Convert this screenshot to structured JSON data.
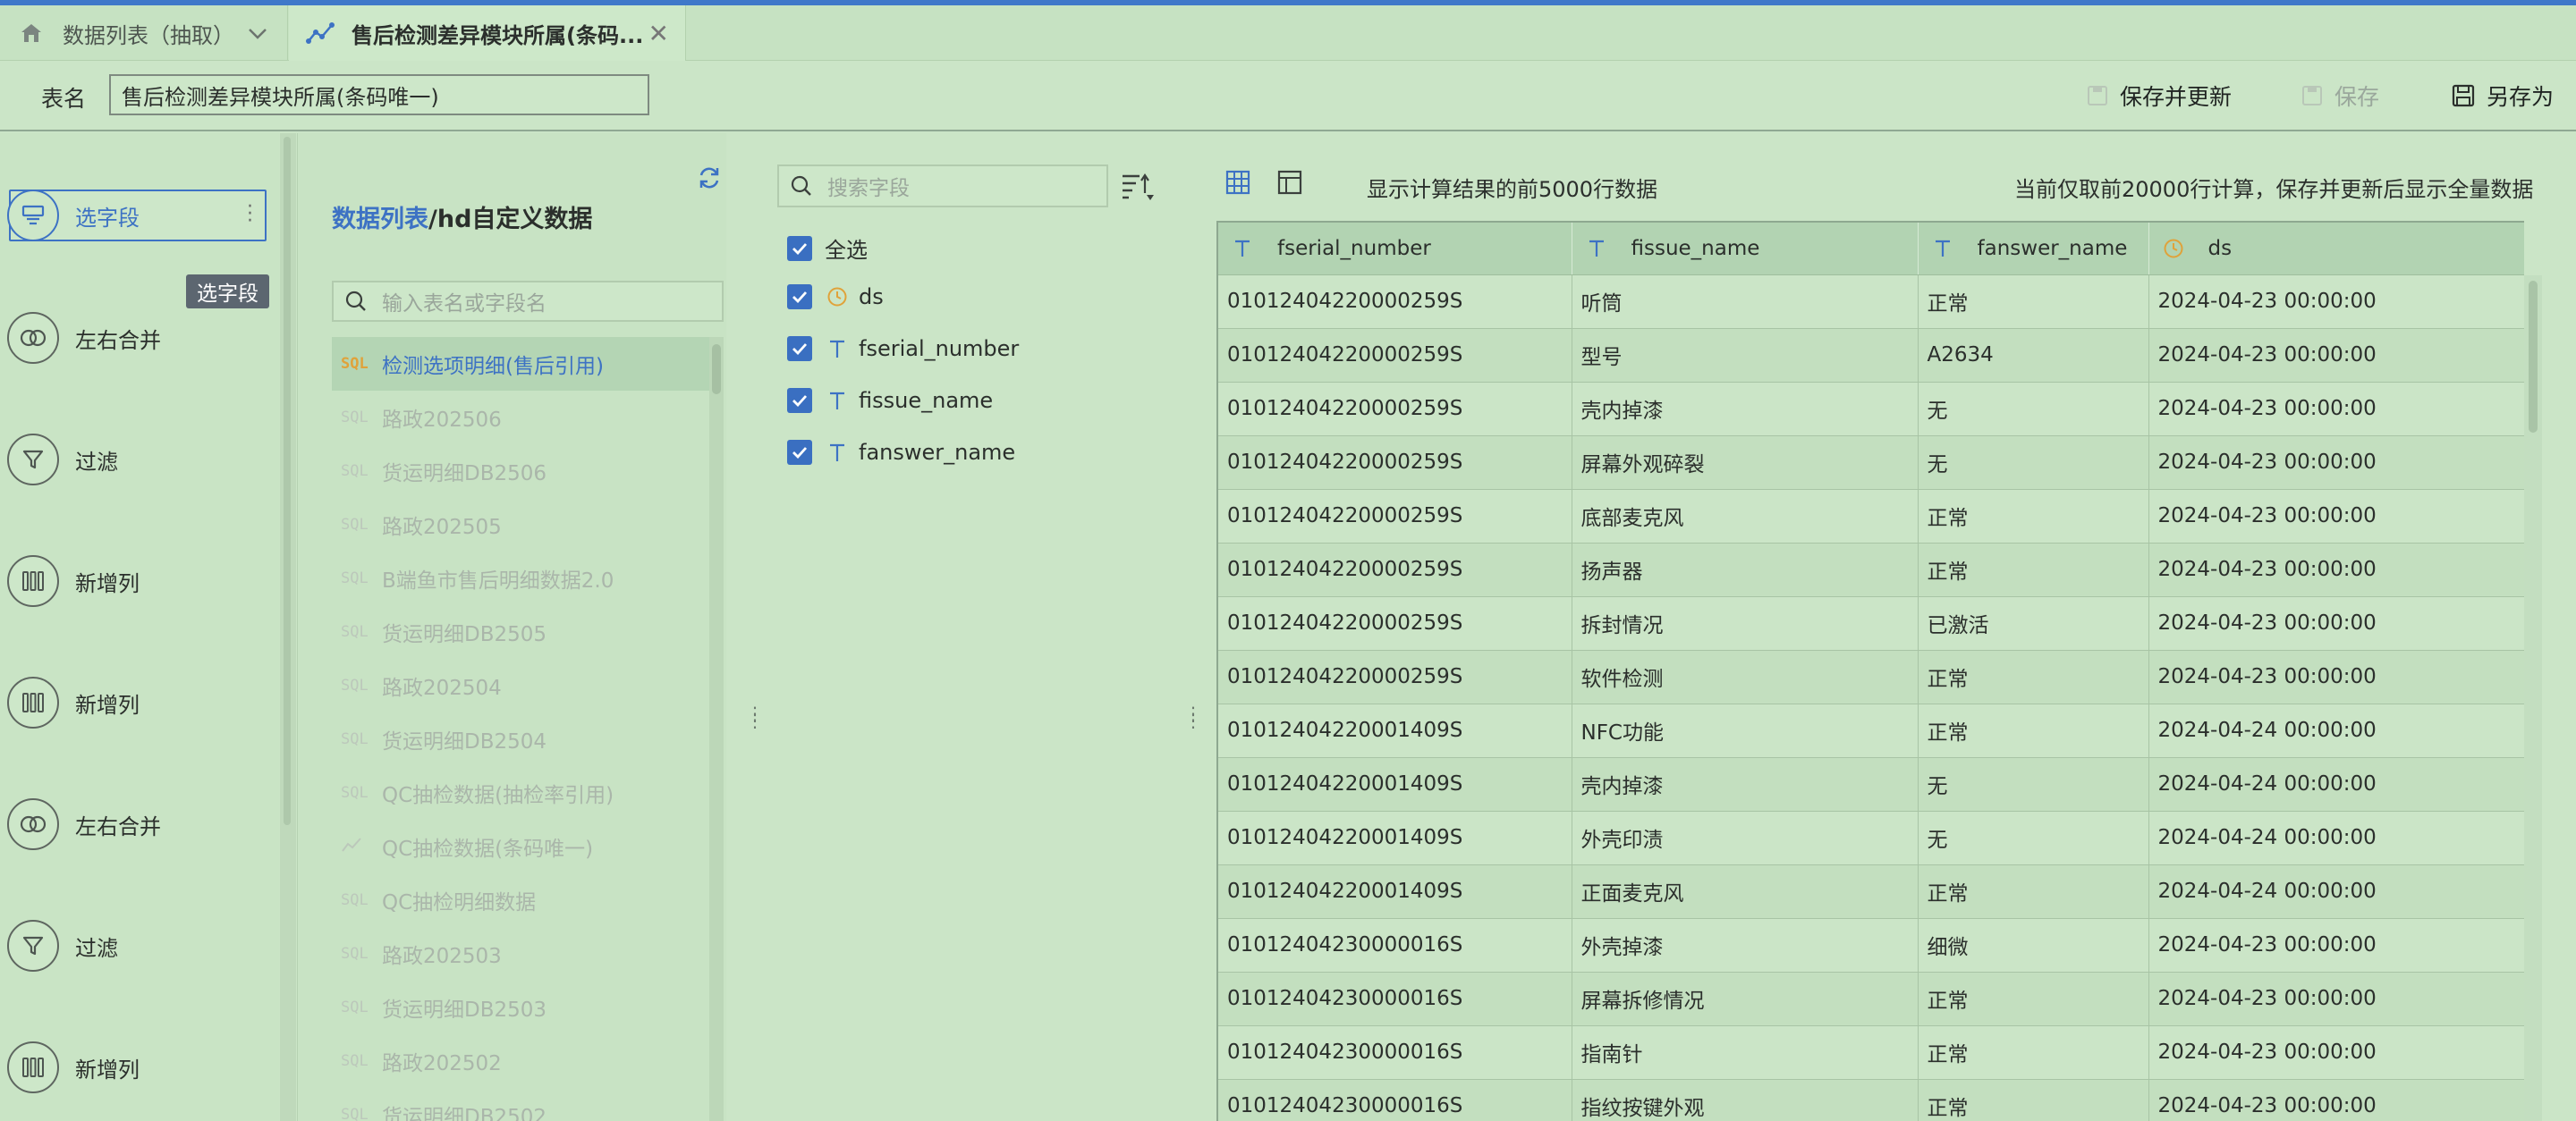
{
  "tabs": [
    {
      "label": "数据列表（抽取）"
    },
    {
      "label": "售后检测差异模块所属(条码..."
    }
  ],
  "name_row": {
    "label": "表名",
    "value": "售后检测差异模块所属(条码唯一)",
    "save_update": "保存并更新",
    "save": "保存",
    "save_as": "另存为"
  },
  "steps": [
    {
      "label": "选字段",
      "icon": "select-field-icon"
    },
    {
      "label": "左右合并",
      "icon": "merge-icon"
    },
    {
      "label": "过滤",
      "icon": "filter-icon"
    },
    {
      "label": "新增列",
      "icon": "add-column-icon"
    },
    {
      "label": "新增列",
      "icon": "add-column-icon"
    },
    {
      "label": "左右合并",
      "icon": "merge-icon"
    },
    {
      "label": "过滤",
      "icon": "filter-icon"
    },
    {
      "label": "新增列",
      "icon": "add-column-icon"
    }
  ],
  "tooltip": "选字段",
  "source": {
    "title_link": "数据列表",
    "title_rest": "/hd自定义数据",
    "search_placeholder": "输入表名或字段名",
    "items": [
      {
        "tag": "SQL",
        "label": "检测选项明细(售后引用)"
      },
      {
        "tag": "SQL",
        "label": "路政202506"
      },
      {
        "tag": "SQL",
        "label": "货运明细DB2506"
      },
      {
        "tag": "SQL",
        "label": "路政202505"
      },
      {
        "tag": "SQL",
        "label": "B端鱼市售后明细数据2.0"
      },
      {
        "tag": "SQL",
        "label": "货运明细DB2505"
      },
      {
        "tag": "SQL",
        "label": "路政202504"
      },
      {
        "tag": "SQL",
        "label": "货运明细DB2504"
      },
      {
        "tag": "SQL",
        "label": "QC抽检数据(抽检率引用)"
      },
      {
        "tag": "",
        "label": "QC抽检数据(条码唯一)"
      },
      {
        "tag": "SQL",
        "label": "QC抽检明细数据"
      },
      {
        "tag": "SQL",
        "label": "路政202503"
      },
      {
        "tag": "SQL",
        "label": "货运明细DB2503"
      },
      {
        "tag": "SQL",
        "label": "路政202502"
      },
      {
        "tag": "SQL",
        "label": "货运明细DB2502"
      }
    ]
  },
  "fields": {
    "search_placeholder": "搜索字段",
    "select_all": "全选",
    "items": [
      {
        "name": "ds",
        "type": "date"
      },
      {
        "name": "fserial_number",
        "type": "text"
      },
      {
        "name": "fissue_name",
        "type": "text"
      },
      {
        "name": "fanswer_name",
        "type": "text"
      }
    ]
  },
  "preview": {
    "info": "显示计算结果的前5000行数据",
    "note": "当前仅取前20000行计算，保存并更新后显示全量数据",
    "columns": [
      {
        "name": "fserial_number",
        "type": "text"
      },
      {
        "name": "fissue_name",
        "type": "text"
      },
      {
        "name": "fanswer_name",
        "type": "text"
      },
      {
        "name": "ds",
        "type": "date"
      }
    ],
    "rows": [
      [
        "01012404220000259S",
        "听筒",
        "正常",
        "2024-04-23 00:00:00"
      ],
      [
        "01012404220000259S",
        "型号",
        "A2634",
        "2024-04-23 00:00:00"
      ],
      [
        "01012404220000259S",
        "壳内掉漆",
        "无",
        "2024-04-23 00:00:00"
      ],
      [
        "01012404220000259S",
        "屏幕外观碎裂",
        "无",
        "2024-04-23 00:00:00"
      ],
      [
        "01012404220000259S",
        "底部麦克风",
        "正常",
        "2024-04-23 00:00:00"
      ],
      [
        "01012404220000259S",
        "扬声器",
        "正常",
        "2024-04-23 00:00:00"
      ],
      [
        "01012404220000259S",
        "拆封情况",
        "已激活",
        "2024-04-23 00:00:00"
      ],
      [
        "01012404220000259S",
        "软件检测",
        "正常",
        "2024-04-23 00:00:00"
      ],
      [
        "01012404220001409S",
        "NFC功能",
        "正常",
        "2024-04-24 00:00:00"
      ],
      [
        "01012404220001409S",
        "壳内掉漆",
        "无",
        "2024-04-24 00:00:00"
      ],
      [
        "01012404220001409S",
        "外壳印渍",
        "无",
        "2024-04-24 00:00:00"
      ],
      [
        "01012404220001409S",
        "正面麦克风",
        "正常",
        "2024-04-24 00:00:00"
      ],
      [
        "01012404230000016S",
        "外壳掉漆",
        "细微",
        "2024-04-23 00:00:00"
      ],
      [
        "01012404230000016S",
        "屏幕拆修情况",
        "正常",
        "2024-04-23 00:00:00"
      ],
      [
        "01012404230000016S",
        "指南针",
        "正常",
        "2024-04-23 00:00:00"
      ],
      [
        "01012404230000016S",
        "指纹按键外观",
        "正常",
        "2024-04-23 00:00:00"
      ]
    ]
  },
  "colors": {
    "accent": "#3d72c4",
    "background": "#cbe5c7",
    "sql_tag": "#e0a23a"
  }
}
